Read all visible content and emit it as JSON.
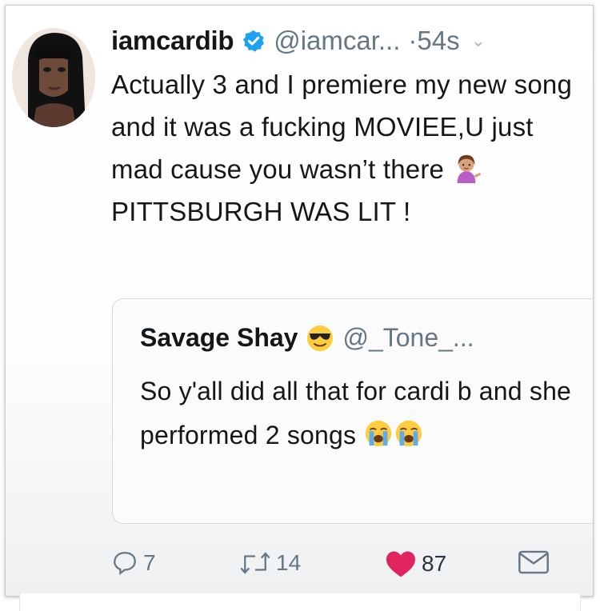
{
  "tweet": {
    "display_name": "iamcardib",
    "handle": "@iamcar...",
    "time": "·54s",
    "text_part1": "Actually 3 and I premiere my new song and it was a fucking MOVIEE,U just mad cause you wasn’t there",
    "text_part2": "PITTSBURGH WAS LIT !"
  },
  "quoted_tweet": {
    "display_name": "Savage Shay",
    "handle": "@_Tone_...",
    "text": "So y'all did all that for cardi b and she performed 2 songs"
  },
  "actions": {
    "replies": "7",
    "retweets": "14",
    "likes": "87"
  },
  "icons": {
    "verified": "verified-badge-icon",
    "chevron": "chevron-down-icon",
    "woman_tipping_hand": "woman-tipping-hand-icon",
    "sunglasses": "smiling-face-with-sunglasses-icon",
    "crying": "loudly-crying-face-icon",
    "reply": "reply-icon",
    "retweet": "retweet-icon",
    "like": "heart-icon",
    "dm": "envelope-icon"
  },
  "colors": {
    "verified_blue": "#1da1f2",
    "like_red": "#e0245e",
    "secondary_text": "#657786"
  }
}
